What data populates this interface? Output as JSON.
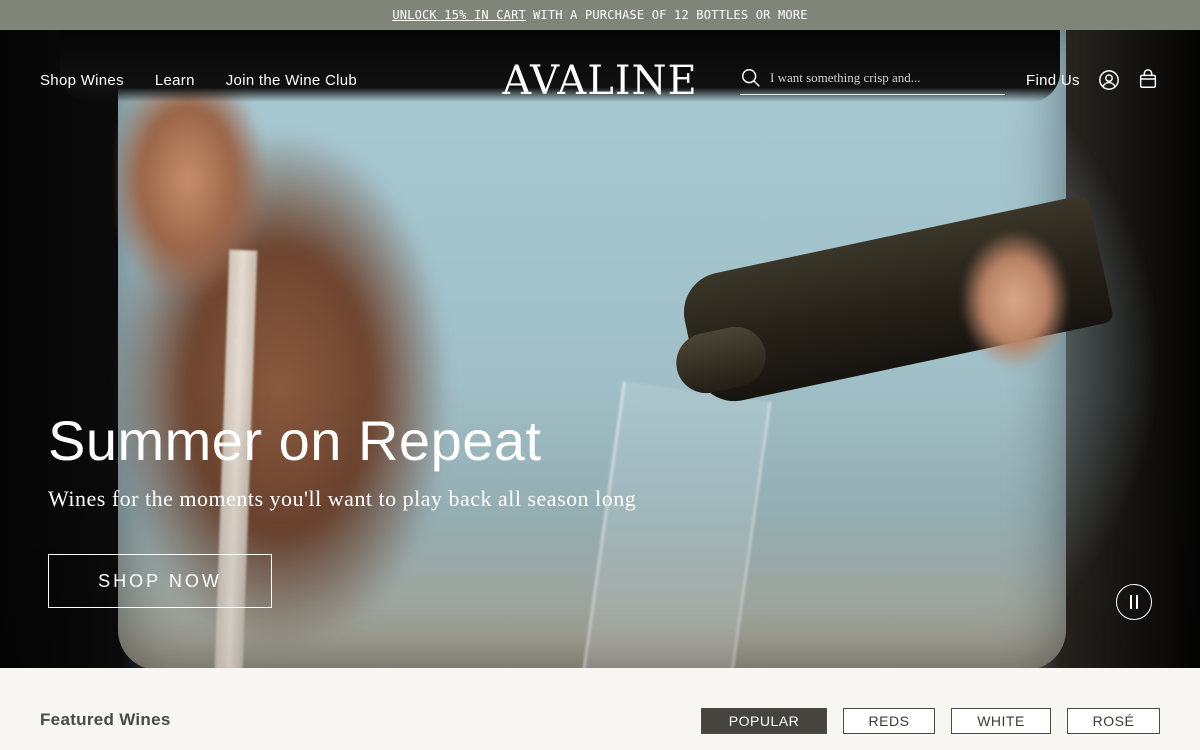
{
  "announcement": {
    "link_text": "UNLOCK 15% IN CART",
    "text": "WITH A PURCHASE OF 12 BOTTLES OR MORE"
  },
  "header": {
    "nav": [
      {
        "label": "Shop Wines"
      },
      {
        "label": "Learn"
      },
      {
        "label": "Join the Wine Club"
      }
    ],
    "logo": "AVALINE",
    "search": {
      "placeholder": "I want something crisp and..."
    },
    "find_us": "Find Us",
    "icons": [
      "search-icon",
      "account-icon",
      "bag-icon"
    ]
  },
  "hero": {
    "title": "Summer on Repeat",
    "subtitle": "Wines for the moments you'll want to play back all season long",
    "cta": "SHOP NOW",
    "video_control": "pause-icon"
  },
  "featured": {
    "title": "Featured Wines",
    "filters": [
      {
        "label": "POPULAR",
        "active": true
      },
      {
        "label": "REDS",
        "active": false
      },
      {
        "label": "WHITE",
        "active": false
      },
      {
        "label": "ROSÉ",
        "active": false
      }
    ]
  },
  "colors": {
    "announcement_bg": "#7f8679",
    "active_filter_bg": "#46443e",
    "page_bg": "#f7f6f3"
  }
}
